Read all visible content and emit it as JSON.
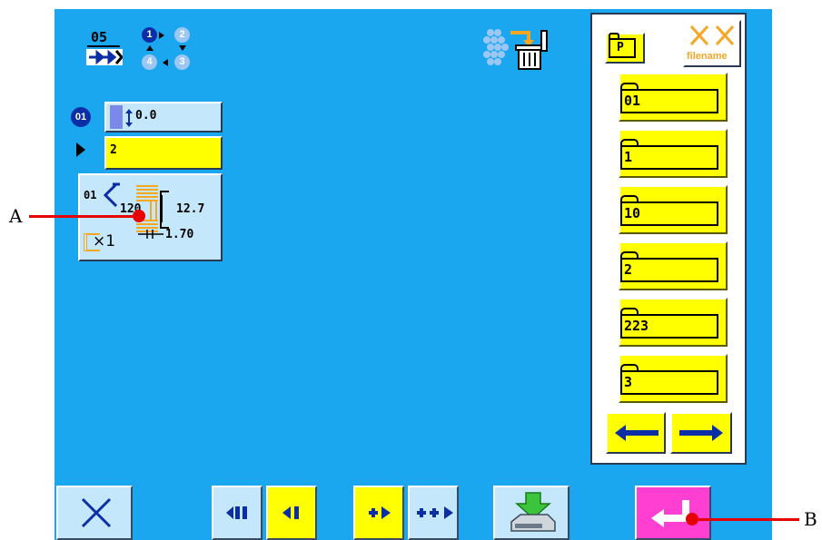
{
  "header": {
    "mode_number": "05",
    "step_labels": [
      "1",
      "2",
      "4",
      "3"
    ]
  },
  "pattern": {
    "number_badge": "01",
    "height_value": "0.0",
    "name_value": "2",
    "stitch_count": "120",
    "width_value": "12.7",
    "pitch_value": "1.70",
    "repeat_label": "×1",
    "sub_number": "01"
  },
  "file_panel": {
    "folder_label": "P",
    "filename_label": "filename",
    "files": [
      "01",
      "1",
      "10",
      "2",
      "223",
      "3"
    ]
  },
  "annotations": {
    "a": "A",
    "b": "B"
  },
  "colors": {
    "screen_bg": "#1aa7f0",
    "yellow": "#ffff00",
    "panel_blue": "#c4e7fb",
    "enter_pink": "#ff3fd2",
    "nav_blue": "#0b2ea6",
    "annotation_red": "#e60000"
  },
  "icons": {
    "cancel": "close-x-icon",
    "prev_fast": "double-left-arrow-icon",
    "prev": "left-arrow-icon",
    "next": "right-arrow-icon",
    "next_fast": "double-right-arrow-icon",
    "save": "save-to-disk-icon",
    "enter": "enter-return-icon",
    "delete": "trash-icon"
  }
}
